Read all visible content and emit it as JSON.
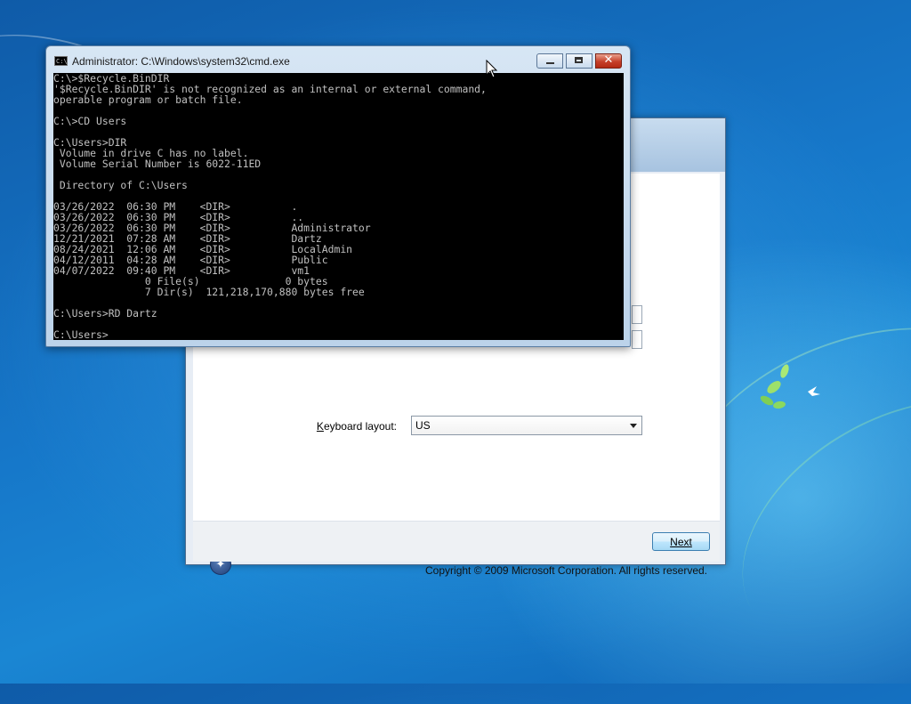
{
  "cmd_window": {
    "title": "Administrator: C:\\Windows\\system32\\cmd.exe",
    "icon_text": "C:\\",
    "console_lines": [
      "C:\\>$Recycle.BinDIR",
      "'$Recycle.BinDIR' is not recognized as an internal or external command,",
      "operable program or batch file.",
      "",
      "C:\\>CD Users",
      "",
      "C:\\Users>DIR",
      " Volume in drive C has no label.",
      " Volume Serial Number is 6022-11ED",
      "",
      " Directory of C:\\Users",
      "",
      "03/26/2022  06:30 PM    <DIR>          .",
      "03/26/2022  06:30 PM    <DIR>          ..",
      "03/26/2022  06:30 PM    <DIR>          Administrator",
      "12/21/2021  07:28 AM    <DIR>          Dartz",
      "08/24/2021  12:06 AM    <DIR>          LocalAdmin",
      "04/12/2011  04:28 AM    <DIR>          Public",
      "04/07/2022  09:40 PM    <DIR>          vm1",
      "               0 File(s)              0 bytes",
      "               7 Dir(s)  121,218,170,880 bytes free",
      "",
      "C:\\Users>RD Dartz",
      "",
      "C:\\Users>"
    ]
  },
  "setup_window": {
    "keyboard_label_accel": "K",
    "keyboard_label_rest": "eyboard layout:",
    "keyboard_value": "US",
    "copyright": "Copyright © 2009 Microsoft Corporation.  All rights reserved.",
    "next_button": "Next"
  },
  "icons": {
    "cmd_icon": "command-prompt-icon",
    "minimize": "minimize-icon",
    "maximize": "maximize-icon",
    "close": "close-icon",
    "dropdown": "chevron-down-icon",
    "ms_logo": "windows-logo-icon",
    "cursor": "mouse-pointer-icon"
  }
}
